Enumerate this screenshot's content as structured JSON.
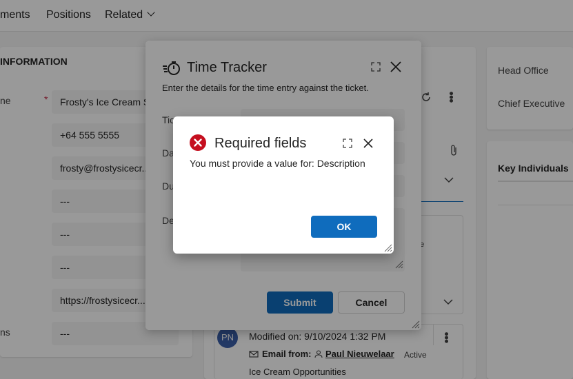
{
  "nav": {
    "tabs": [
      "ments",
      "Positions",
      "Related"
    ]
  },
  "left_card": {
    "section_title": "INFORMATION",
    "labels": [
      "ne",
      "ns"
    ],
    "required_marker": "*",
    "fields": [
      "Frosty's Ice Cream S",
      "+64 555 5555",
      "frosty@frostysicecr...",
      "---",
      "---",
      "---",
      "https://frostysicecr...",
      "---"
    ]
  },
  "right_cards": {
    "head_office": "Head Office",
    "chief_executive": "Chief Executive",
    "key_individuals": "Key Individuals"
  },
  "timeline": {
    "avatar_initials": "PN",
    "modified": "Modified on: 9/10/2024 1:32 PM",
    "email_from_label": "Email from:",
    "sender": "Paul Nieuwelaar",
    "status": "Active",
    "subject": "Ice Cream Opportunities",
    "partial_status": "e"
  },
  "time_tracker": {
    "title": "Time Tracker",
    "subtitle": "Enter the details for the time entry against the ticket.",
    "labels": [
      "Tic",
      "Da",
      "Du",
      "De"
    ],
    "submit_label": "Submit",
    "cancel_label": "Cancel"
  },
  "alert": {
    "title": "Required fields",
    "message": "You must provide a value for: Description",
    "ok_label": "OK",
    "error_color": "#c50f1f"
  },
  "colors": {
    "primary": "#0f6cbd"
  },
  "icons": {
    "time_tracker": "stopwatch-icon",
    "alert": "error-circle-icon",
    "expand": "expand-icon",
    "close": "close-icon",
    "refresh": "refresh-icon",
    "attach": "paperclip-icon",
    "more": "more-vertical-icon",
    "resize": "resize-grip-icon",
    "email": "email-icon",
    "person": "person-icon"
  }
}
